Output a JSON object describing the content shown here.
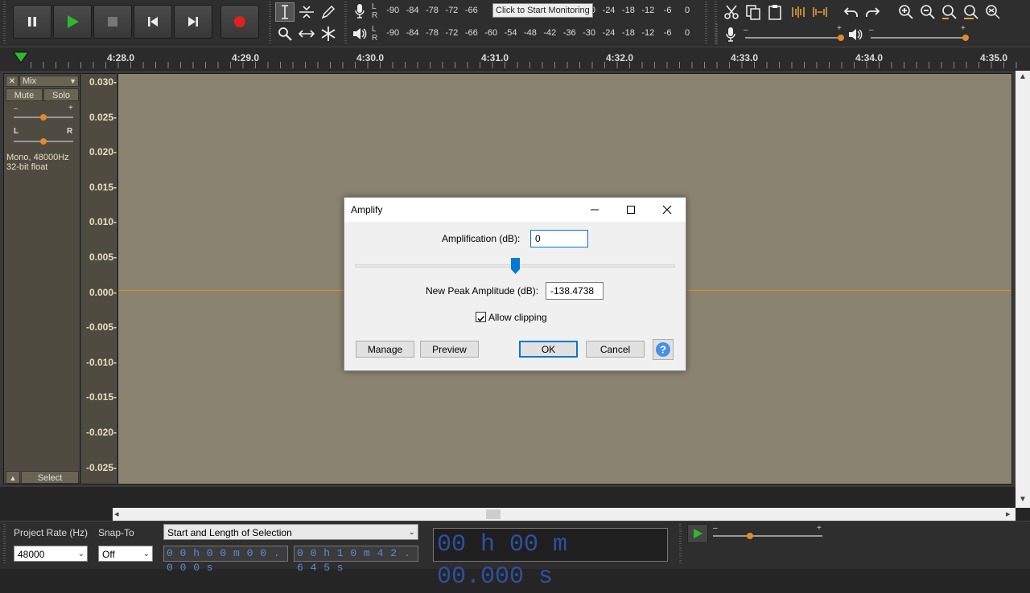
{
  "meter_record": {
    "lr": "L\nR",
    "ticks": [
      "-90",
      "-84",
      "-78",
      "-72",
      "-66",
      "",
      "",
      "",
      "",
      "",
      "-30",
      "-24",
      "-18",
      "-12",
      "-6",
      "0"
    ],
    "monitor_label": "Click to Start Monitoring"
  },
  "meter_play": {
    "lr": "L\nR",
    "ticks": [
      "-90",
      "-84",
      "-78",
      "-72",
      "-66",
      "-60",
      "-54",
      "-48",
      "-42",
      "-36",
      "-30",
      "-24",
      "-18",
      "-12",
      "-6",
      "0"
    ]
  },
  "ruler": {
    "labels": [
      "4:28.0",
      "4:29.0",
      "4:30.0",
      "4:31.0",
      "4:32.0",
      "4:33.0",
      "4:34.0",
      "4:35.0"
    ]
  },
  "track": {
    "name": "Mix",
    "mute": "Mute",
    "solo": "Solo",
    "gain_minus": "–",
    "gain_plus": "+",
    "pan_l": "L",
    "pan_r": "R",
    "info_line1": "Mono, 48000Hz",
    "info_line2": "32-bit float",
    "select": "Select",
    "collapse": "▲",
    "close": "✕",
    "menu_arrow": "▼"
  },
  "vruler": {
    "labels": [
      "0.030-",
      "0.025-",
      "0.020-",
      "0.015-",
      "0.010-",
      "0.005-",
      "0.000-",
      "-0.005-",
      "-0.010-",
      "-0.015-",
      "-0.020-",
      "-0.025-"
    ]
  },
  "bottom": {
    "project_rate_label": "Project Rate (Hz)",
    "project_rate_value": "48000",
    "snap_label": "Snap-To",
    "snap_value": "Off",
    "selection_mode": "Start and Length of Selection",
    "sel_start": "0 0 h 0 0 m 0 0 . 0 0 0 s",
    "sel_length": "0 0 h 1 0 m 4 2 . 6 4 5 s",
    "big_time": "00 h 00 m 00.000 s",
    "play_minus": "–",
    "play_plus": "+"
  },
  "dialog": {
    "title": "Amplify",
    "amp_label": "Amplification (dB):",
    "amp_value": "0",
    "peak_label": "New Peak Amplitude (dB):",
    "peak_value": "-138.4738",
    "allow_clipping": "Allow clipping",
    "allow_clipping_checked": true,
    "slider_fraction": 0.5,
    "manage": "Manage",
    "preview": "Preview",
    "ok": "OK",
    "cancel": "Cancel",
    "help": "?"
  },
  "colors": {
    "waveform_bg": "#8a8370",
    "zero_line": "#e08a2b",
    "record_red": "#e02020",
    "play_green": "#2fb82f",
    "accent_blue": "#0078d7"
  }
}
